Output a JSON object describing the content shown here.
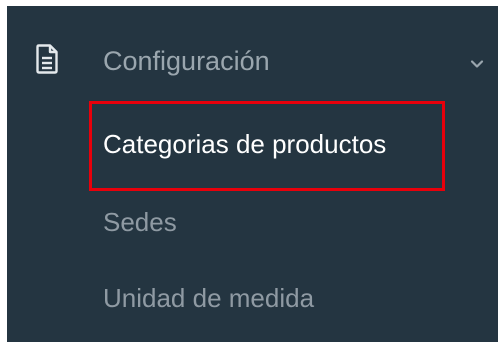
{
  "menu": {
    "header": {
      "label": "Configuración",
      "icon": "document-icon",
      "expand_icon": "chevron-down-icon"
    },
    "items": [
      {
        "label": "Categorias de productos",
        "active": true
      },
      {
        "label": "Sedes",
        "active": false
      },
      {
        "label": "Unidad de medida",
        "active": false
      }
    ]
  },
  "colors": {
    "sidebar_bg": "#243541",
    "highlight_border": "#e8000b",
    "active_text": "#ffffff",
    "inactive_text": "#8f9aa3"
  }
}
